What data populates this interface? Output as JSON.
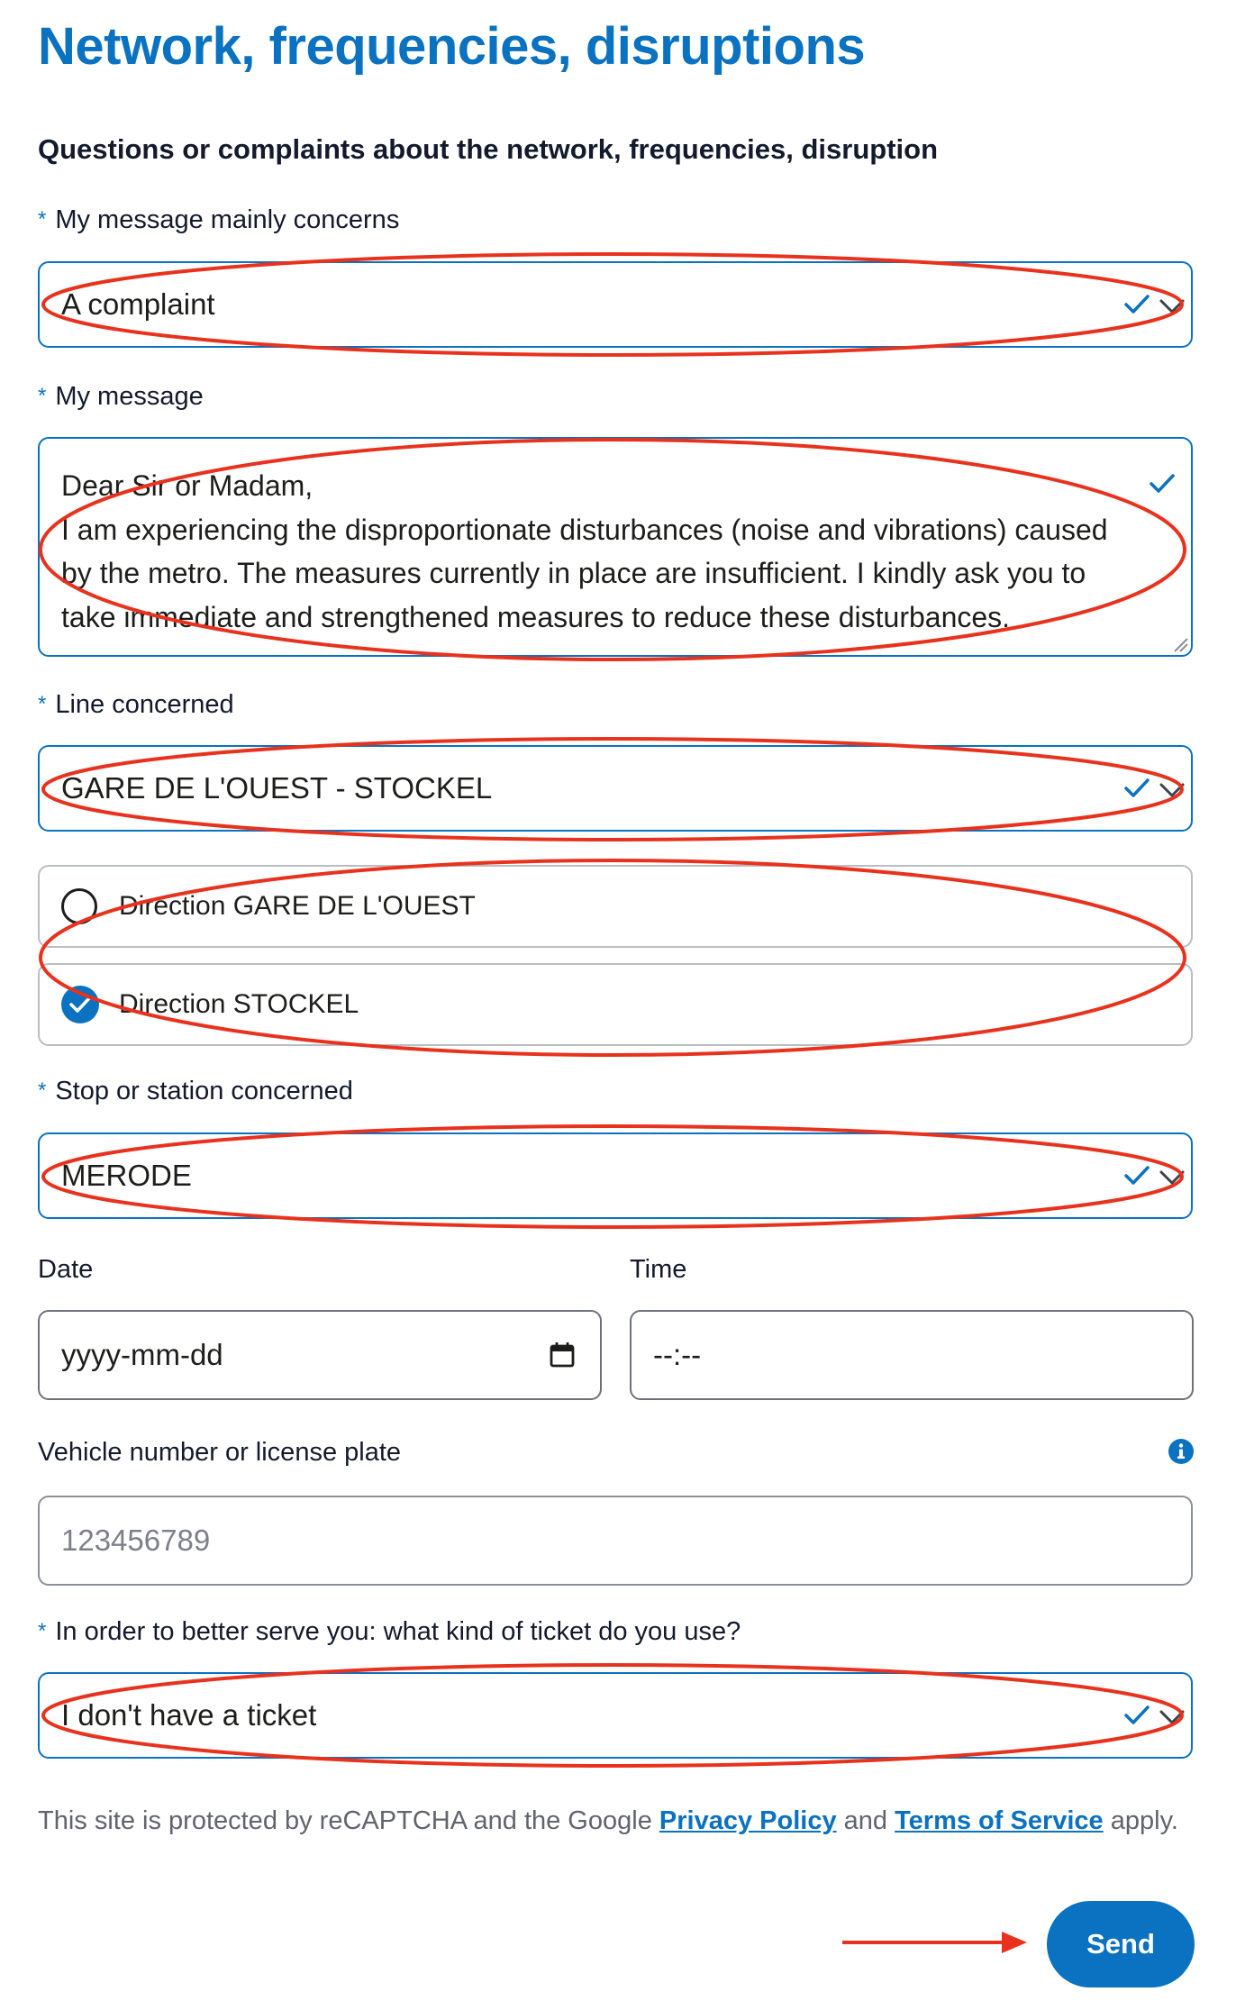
{
  "page": {
    "title": "Network, frequencies, disruptions",
    "section_title": "Questions or complaints about the network, frequencies, disruption"
  },
  "required_marker": "*",
  "form": {
    "concerns": {
      "label": "My message mainly concerns",
      "value": "A complaint"
    },
    "message": {
      "label": "My message",
      "value": "Dear Sir or Madam,\nI am experiencing the disproportionate disturbances (noise and vibrations) caused by the metro. The measures currently in place are insufficient. I kindly ask you to take immediate and strengthened measures to reduce these disturbances."
    },
    "line": {
      "label": "Line concerned",
      "value": "GARE DE L'OUEST - STOCKEL",
      "directions": [
        {
          "label": "Direction GARE DE L'OUEST",
          "checked": false
        },
        {
          "label": "Direction STOCKEL",
          "checked": true
        }
      ]
    },
    "stop": {
      "label": "Stop or station concerned",
      "value": "MERODE"
    },
    "date": {
      "label": "Date",
      "placeholder": "yyyy-mm-dd"
    },
    "time": {
      "label": "Time",
      "placeholder": "--:--"
    },
    "vehicle": {
      "label": "Vehicle number or license plate",
      "placeholder": "123456789",
      "info_icon": "info-icon"
    },
    "ticket": {
      "label": "In order to better serve you: what kind of ticket do you use?",
      "value": "I don't have a ticket"
    }
  },
  "recaptcha": {
    "prefix": "This site is protected by reCAPTCHA and the Google",
    "privacy_link": "Privacy Policy",
    "and": "and",
    "terms_link": "Terms of Service",
    "suffix": "apply."
  },
  "send_label": "Send",
  "colors": {
    "accent": "#0a72c0",
    "annotation": "#e8321d",
    "text": "#1d1d1b"
  }
}
